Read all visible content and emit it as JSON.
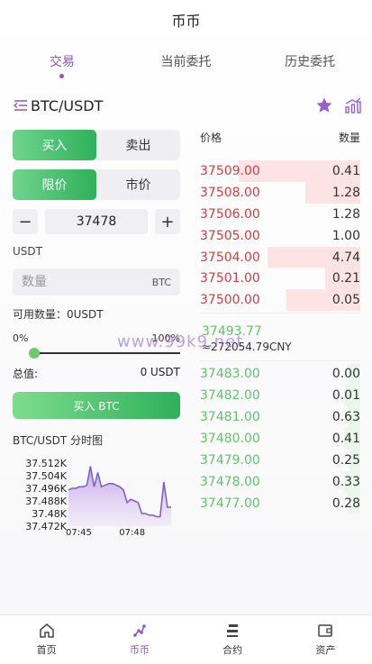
{
  "header": {
    "title": "币币"
  },
  "tabs": [
    {
      "label": "交易",
      "active": true
    },
    {
      "label": "当前委托",
      "active": false
    },
    {
      "label": "历史委托",
      "active": false
    }
  ],
  "pair": {
    "title": "BTC/USDT",
    "icons": [
      "menu-icon",
      "star-icon",
      "chart-icon"
    ]
  },
  "trade": {
    "side_buy": "买入",
    "side_sell": "卖出",
    "type_limit": "限价",
    "type_market": "市价",
    "minus": "−",
    "plus": "+",
    "price_value": "37478",
    "currency_label": "USDT",
    "qty_placeholder": "数量",
    "qty_unit": "BTC",
    "available": "可用数量：0USDT",
    "pct_min": "0%",
    "pct_max": "100%",
    "slider_value": 0,
    "total_label": "总值:",
    "total_value": "0 USDT",
    "buy_button": "买入 BTC"
  },
  "chart_data": {
    "type": "area",
    "title": "BTC/USDT 分时图",
    "y_ticks": [
      "37.512K",
      "37.504K",
      "37.496K",
      "37.488K",
      "37.48K",
      "37.472K"
    ],
    "x_ticks": [
      "07:45",
      "07:48"
    ],
    "ylim": [
      37472,
      37512
    ],
    "values": [
      37495,
      37496,
      37496,
      37497,
      37497,
      37498,
      37510,
      37497,
      37506,
      37497,
      37498,
      37499,
      37499,
      37498,
      37497,
      37495,
      37487,
      37489,
      37488,
      37487,
      37480,
      37480,
      37479,
      37479,
      37478,
      37478,
      37500,
      37484,
      37484
    ]
  },
  "orderbook": {
    "price_header": "价格",
    "qty_header": "数量",
    "asks": [
      {
        "price": "37509.00",
        "qty": "0.41",
        "depth": 0.76
      },
      {
        "price": "37508.00",
        "qty": "1.28",
        "depth": 0.34
      },
      {
        "price": "37506.00",
        "qty": "1.28",
        "depth": 0.0
      },
      {
        "price": "37505.00",
        "qty": "1.00",
        "depth": 0.0
      },
      {
        "price": "37504.00",
        "qty": "4.74",
        "depth": 0.58
      },
      {
        "price": "37501.00",
        "qty": "0.21",
        "depth": 0.22
      },
      {
        "price": "37500.00",
        "qty": "0.05",
        "depth": 0.46
      }
    ],
    "last_price": "37493.77",
    "last_cny": "≈272054.79CNY",
    "bids": [
      {
        "price": "37483.00",
        "qty": "0.00",
        "depth": 0.08
      },
      {
        "price": "37482.00",
        "qty": "0.01",
        "depth": 0.1
      },
      {
        "price": "37481.00",
        "qty": "0.63",
        "depth": 0.08
      },
      {
        "price": "37480.00",
        "qty": "0.41",
        "depth": 0.1
      },
      {
        "price": "37479.00",
        "qty": "0.25",
        "depth": 0.07
      },
      {
        "price": "37478.00",
        "qty": "0.33",
        "depth": 0.1
      },
      {
        "price": "37477.00",
        "qty": "0.28",
        "depth": 0.08
      }
    ]
  },
  "watermark": "www.99k9.net",
  "nav": [
    {
      "label": "首页",
      "icon": "home-icon",
      "active": false
    },
    {
      "label": "币币",
      "icon": "coin-trade-icon",
      "active": true
    },
    {
      "label": "合约",
      "icon": "contract-icon",
      "active": false
    },
    {
      "label": "资产",
      "icon": "wallet-icon",
      "active": false
    }
  ],
  "colors": {
    "accent": "#8a56c6",
    "buy": "#2eb05a",
    "sell": "#d33c3c"
  }
}
